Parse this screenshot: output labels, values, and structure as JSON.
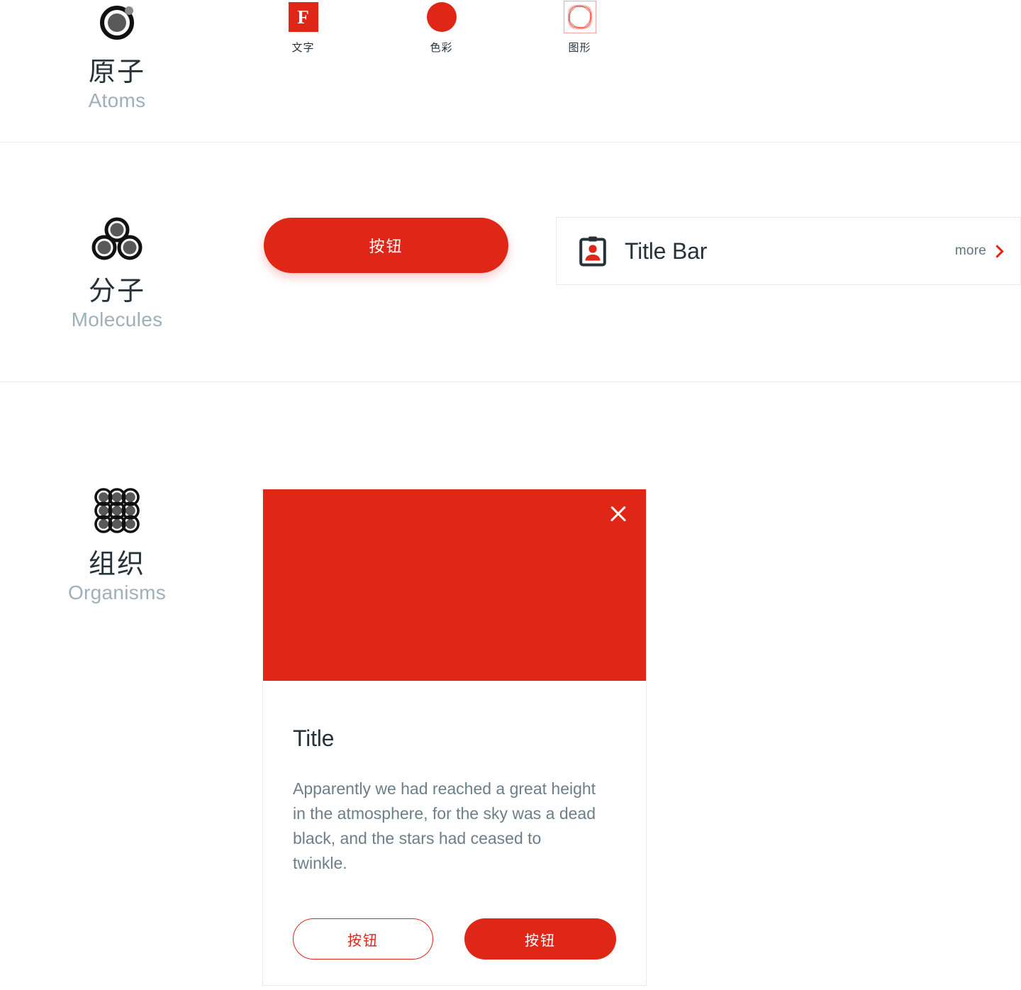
{
  "theme": {
    "accent": "#E02617",
    "ink": "#26323A",
    "muted": "#9FB0BB",
    "body_text": "#6C7F89",
    "border": "#E8EAEC",
    "white": "#FFFFFF"
  },
  "sections": {
    "atoms": {
      "level_cn": "原子",
      "level_en": "Atoms",
      "icon": "atom-icon",
      "items": [
        {
          "caption": "文字",
          "icon": "text-swatch-icon",
          "glyph": "F"
        },
        {
          "caption": "色彩",
          "icon": "color-swatch-icon"
        },
        {
          "caption": "图形",
          "icon": "shape-swatch-icon"
        }
      ]
    },
    "molecules": {
      "level_cn": "分子",
      "level_en": "Molecules",
      "icon": "molecule-icon",
      "button_label": "按钮",
      "title_bar": {
        "icon": "id-badge-icon",
        "title": "Title Bar",
        "more_label": "more",
        "more_icon": "chevron-right-icon"
      }
    },
    "organisms": {
      "level_cn": "组织",
      "level_en": "Organisms",
      "icon": "organism-grid-icon",
      "card": {
        "close_icon": "close-icon",
        "title": "Title",
        "body": "Apparently we had reached a great height in the atmosphere, for the sky was a dead black, and the stars had ceased to twinkle.",
        "secondary_button_label": "按钮",
        "primary_button_label": "按钮"
      }
    }
  }
}
